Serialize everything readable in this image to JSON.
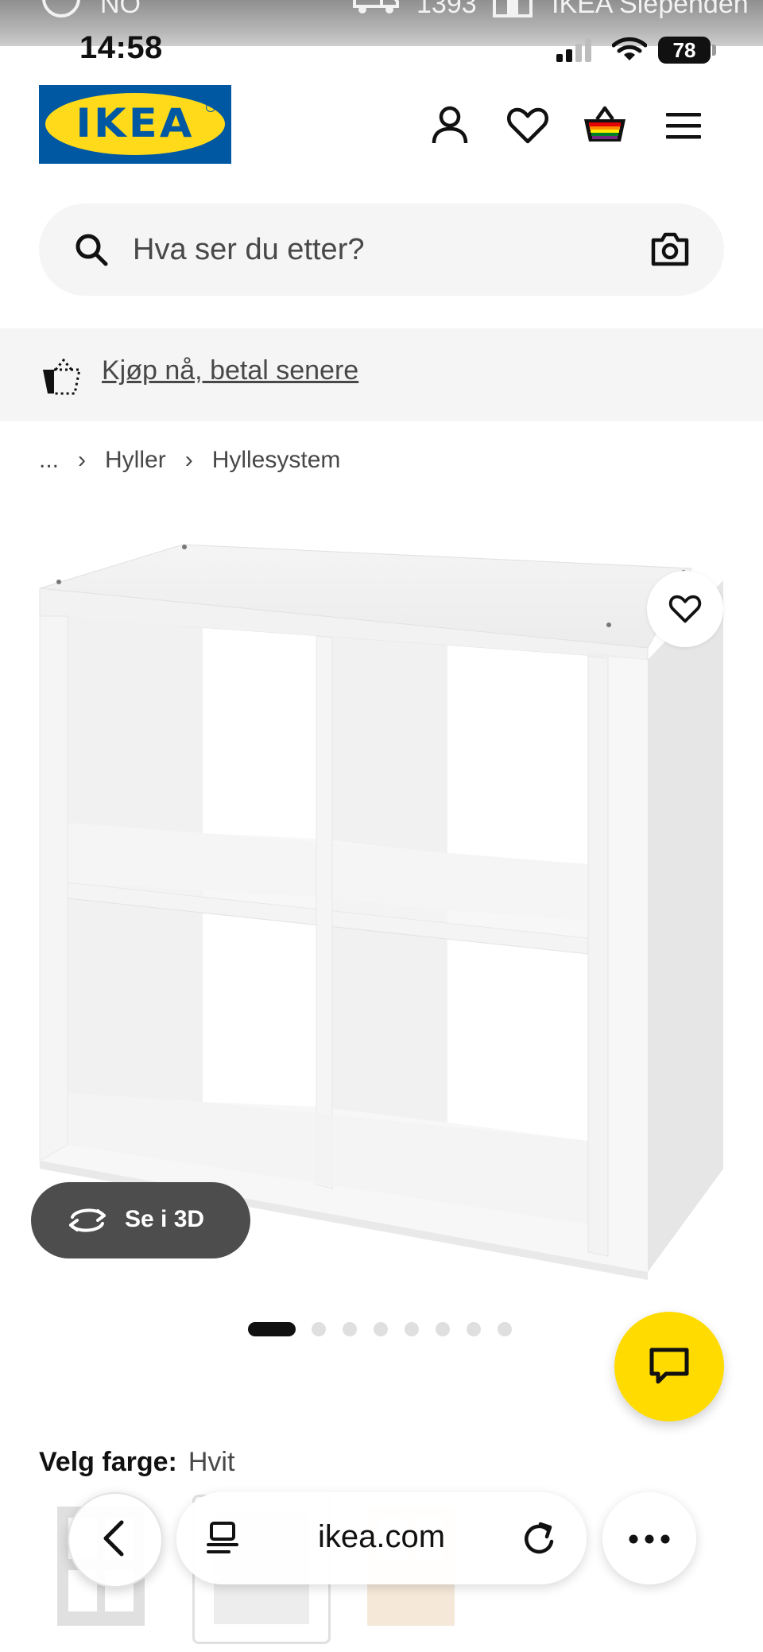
{
  "ghost_bar": {
    "left_text": "NO",
    "phone": "1393",
    "store": "IKEA Slependen"
  },
  "status_bar": {
    "time": "14:58",
    "battery": "78"
  },
  "header": {
    "logo_text": "IKEA",
    "icons": [
      "account-icon",
      "heart-icon",
      "basket-icon",
      "menu-icon"
    ]
  },
  "search": {
    "placeholder": "Hva ser du etter?"
  },
  "promo": {
    "link_text": "Kjøp nå, betal senere"
  },
  "breadcrumb": {
    "items": [
      "...",
      "Hyller",
      "Hyllesystem"
    ]
  },
  "product": {
    "view3d_label": "Se i 3D",
    "gallery": {
      "count": 8,
      "active_index": 0
    }
  },
  "color_selector": {
    "label": "Velg farge:",
    "value": "Hvit"
  },
  "browser": {
    "url": "ikea.com"
  },
  "colors": {
    "ikea_blue": "#0058a3",
    "ikea_yellow": "#ffda1a",
    "chat_yellow": "#ffdb00",
    "view3d_bg": "#4d4d4d"
  }
}
